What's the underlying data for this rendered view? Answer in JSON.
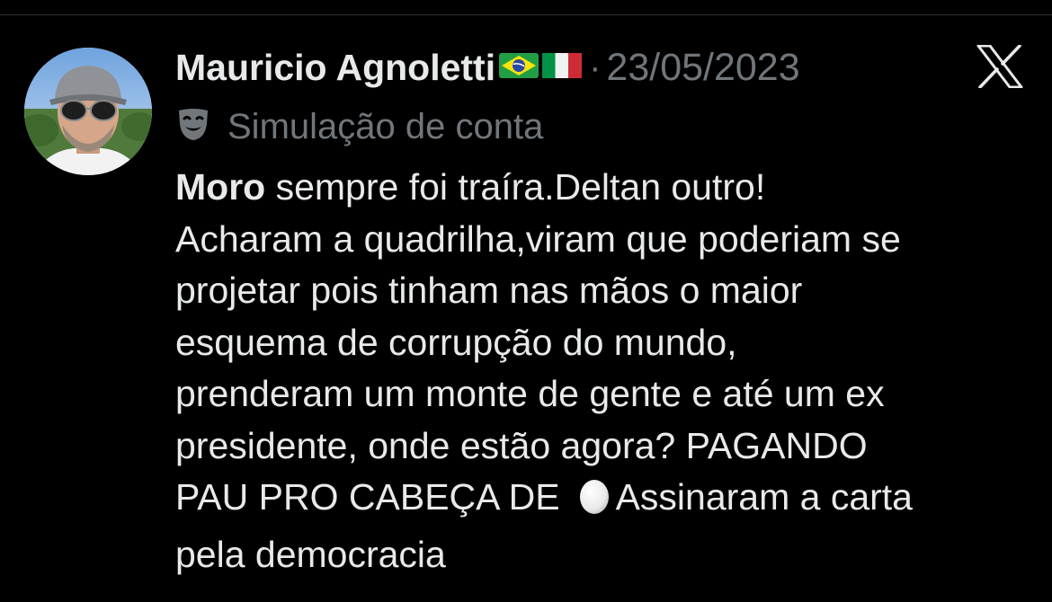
{
  "tweet": {
    "author": {
      "display_name": "Mauricio Agnoletti",
      "flags": [
        "brazil-flag",
        "italy-flag"
      ],
      "avatar": "avatar-photo"
    },
    "separator": "·",
    "date": "23/05/2023",
    "platform_icon": "x-logo-icon",
    "parody_icon": "theater-mask-icon",
    "parody_label": "Simulação de conta",
    "body": {
      "line1_bold": "Moro",
      "line1_rest": " sempre foi traíra.Deltan outro!",
      "line2": "Acharam a quadrilha,viram que poderiam se",
      "line3": "projetar pois tinham nas mãos o maior",
      "line4": "esquema de corrupção do mundo,",
      "line5": "prenderam um monte de gente e até um ex",
      "line6": "presidente, onde estão agora? PAGANDO",
      "line7_before_emoji": "PAU PRO CABEÇA DE",
      "line7_emoji": "egg-icon",
      "line7_after_emoji": "Assinaram a carta",
      "line8": "pela democracia"
    }
  },
  "colors": {
    "background": "#000000",
    "primary_text": "#e7e9ea",
    "secondary_text": "#71767b"
  }
}
